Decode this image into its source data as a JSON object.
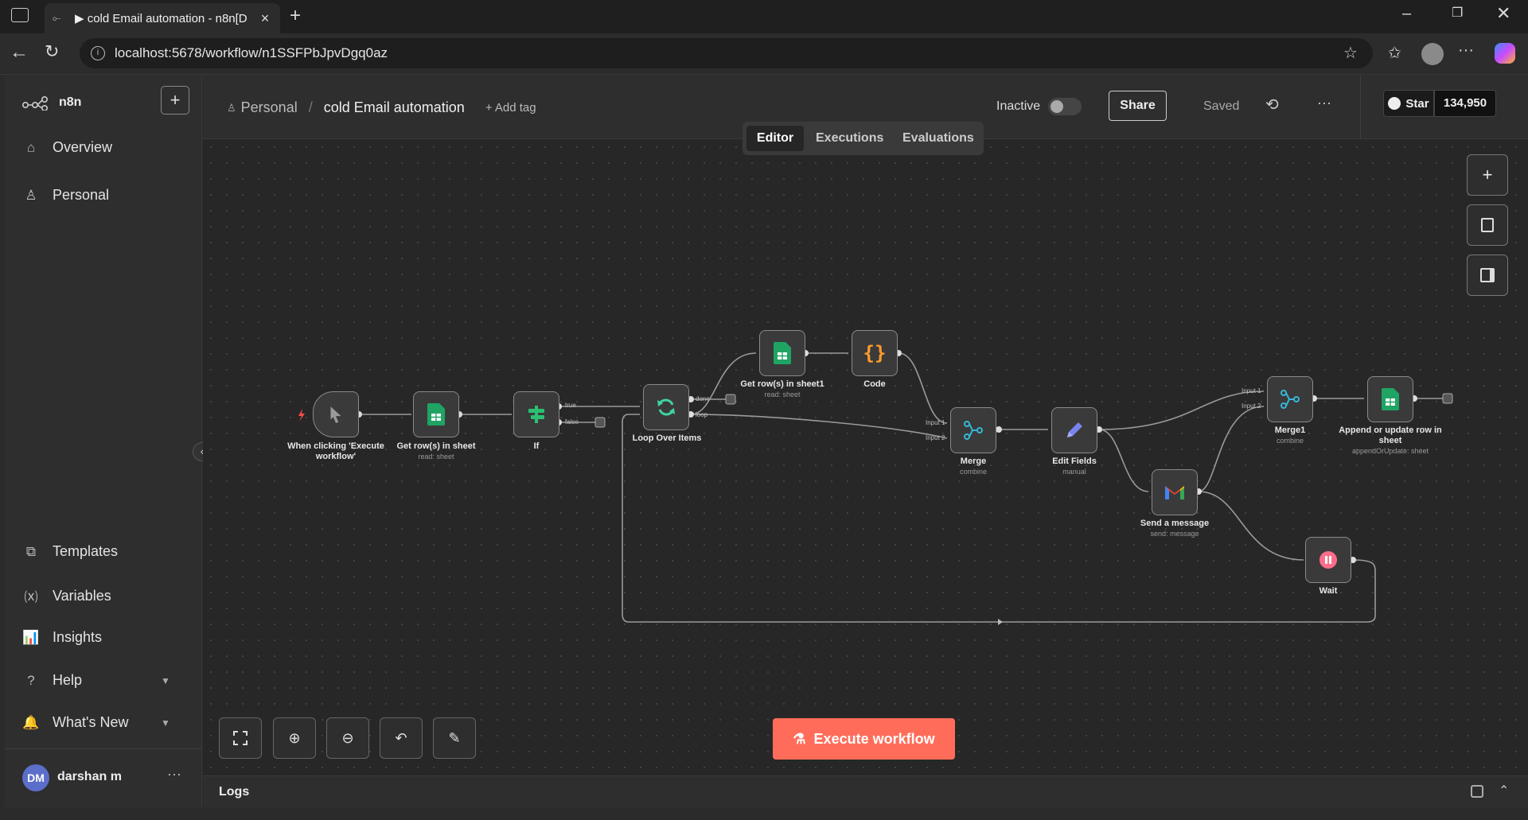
{
  "browser": {
    "tab_title": "▶ cold Email automation - n8n[D",
    "url": "localhost:5678/workflow/n1SSFPbJpvDgq0az"
  },
  "sidebar": {
    "brand": "n8n",
    "items": [
      {
        "label": "Overview"
      },
      {
        "label": "Personal"
      }
    ],
    "bottom_items": [
      {
        "label": "Templates"
      },
      {
        "label": "Variables"
      },
      {
        "label": "Insights"
      },
      {
        "label": "Help"
      },
      {
        "label": "What's New"
      }
    ],
    "user": {
      "initials": "DM",
      "name": "darshan m"
    }
  },
  "header": {
    "project": "Personal",
    "separator": "/",
    "workflow_name": "cold Email automation",
    "add_tag": "+ Add tag",
    "status": "Inactive",
    "share": "Share",
    "saved": "Saved",
    "github_star": "Star",
    "github_count": "134,950"
  },
  "tabs": [
    "Editor",
    "Executions",
    "Evaluations"
  ],
  "nodes": [
    {
      "name": "When clicking 'Execute workflow'",
      "sub": "",
      "icon": "cursor-icon",
      "color": "#9a9a9a"
    },
    {
      "name": "Get row(s) in sheet",
      "sub": "read: sheet",
      "icon": "google-sheets-icon",
      "color": "#1fa463"
    },
    {
      "name": "If",
      "sub": "",
      "icon": "if-icon",
      "color": "#2bbf71"
    },
    {
      "name": "Loop Over Items",
      "sub": "",
      "icon": "loop-icon",
      "color": "#3fd3a3"
    },
    {
      "name": "Get row(s) in sheet1",
      "sub": "read: sheet",
      "icon": "google-sheets-icon",
      "color": "#1fa463"
    },
    {
      "name": "Code",
      "sub": "",
      "icon": "code-icon",
      "color": "#ff9b2b"
    },
    {
      "name": "Merge",
      "sub": "combine",
      "icon": "merge-icon",
      "color": "#35b7d6"
    },
    {
      "name": "Edit Fields",
      "sub": "manual",
      "icon": "pencil-icon",
      "color": "#7b83f0"
    },
    {
      "name": "Send a message",
      "sub": "send: message",
      "icon": "gmail-icon",
      "color": "#ea4335"
    },
    {
      "name": "Merge1",
      "sub": "combine",
      "icon": "merge-icon",
      "color": "#35b7d6"
    },
    {
      "name": "Append or update row in sheet",
      "sub": "appendOrUpdate: sheet",
      "icon": "google-sheets-icon",
      "color": "#1fa463"
    },
    {
      "name": "Wait",
      "sub": "",
      "icon": "pause-icon",
      "color": "#ff6d8a"
    }
  ],
  "port_labels": {
    "if_true": "true",
    "if_false": "false",
    "loop_done": "done",
    "loop_loop": "loop",
    "merge_in1": "Input 1",
    "merge_in2": "Input 2",
    "merge1_in1": "Input 1",
    "merge1_in2": "Input 2"
  },
  "execute_button": "Execute workflow",
  "logs_label": "Logs",
  "colors": {
    "accent": "#ff6d5a",
    "canvas": "#272727"
  }
}
